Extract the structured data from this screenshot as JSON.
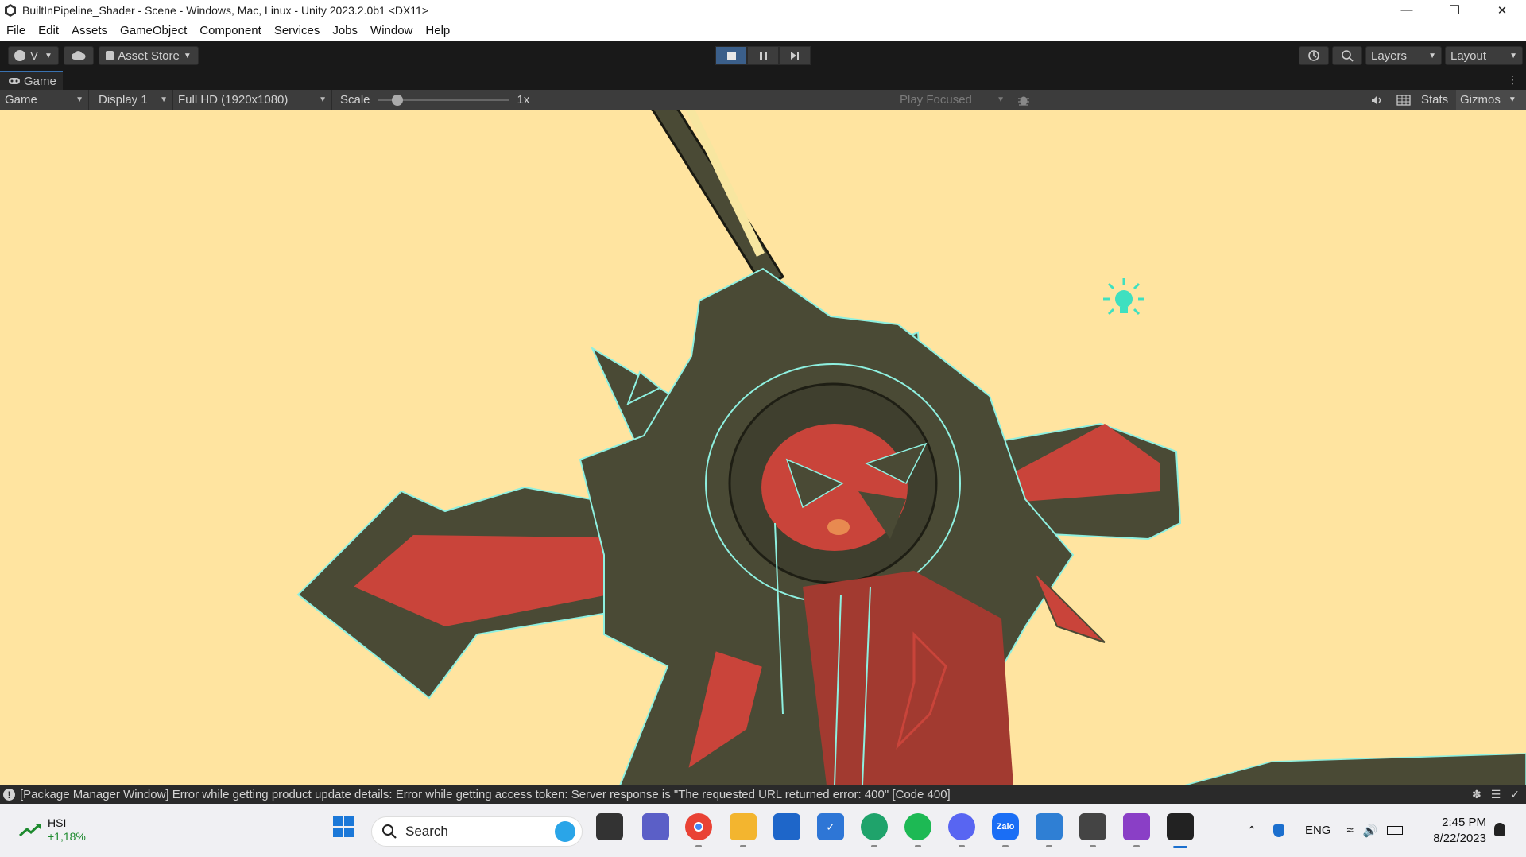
{
  "window": {
    "title": "BuiltInPipeline_Shader - Scene - Windows, Mac, Linux - Unity 2023.2.0b1 <DX11>",
    "minimize_icon": "minimize-icon",
    "restore_icon": "restore-icon",
    "close_icon": "close-icon"
  },
  "menu": [
    "File",
    "Edit",
    "Assets",
    "GameObject",
    "Component",
    "Services",
    "Jobs",
    "Window",
    "Help"
  ],
  "toolbar": {
    "account_label": "V",
    "asset_store_label": "Asset Store",
    "layers_label": "Layers",
    "layout_label": "Layout",
    "play_state": "playing"
  },
  "game_tab": {
    "label": "Game"
  },
  "game_controls": {
    "view_label": "Game",
    "display_label": "Display 1",
    "resolution_label": "Full HD (1920x1080)",
    "scale_label": "Scale",
    "scale_value": "1x",
    "scale_fraction": 0.1,
    "play_focused_label": "Play Focused",
    "stats_label": "Stats",
    "gizmos_label": "Gizmos"
  },
  "status": {
    "message": "[Package Manager Window] Error while getting product update details: Error while getting access token: Server response is \"The requested URL returned error: 400\" [Code 400]"
  },
  "taskbar": {
    "stock_name": "HSI",
    "stock_change": "+1,18%",
    "search_placeholder": "Search",
    "language": "ENG",
    "time": "2:45 PM",
    "date": "8/22/2023",
    "zalo_label": "Zalo"
  },
  "colors": {
    "viewport_bg": "#ffe4a0",
    "editor_dark": "#191919",
    "panel_gray": "#3c3c3c",
    "play_active": "#3b5f8a",
    "model_dark": "#4a4a35",
    "model_red": "#c9443a",
    "outline_cyan": "#8ef0e0",
    "light_gizmo": "#3fe0c0"
  }
}
